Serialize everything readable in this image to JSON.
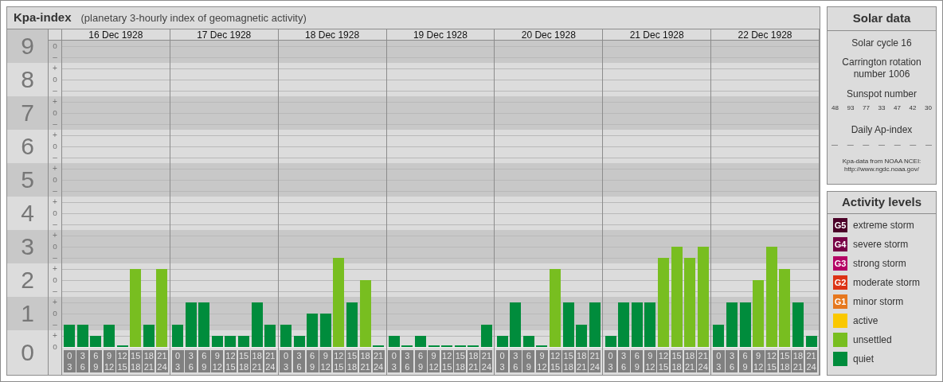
{
  "kpa_panel": {
    "title": "Kpa-index",
    "subtitle": "(planetary 3-hourly index of geomagnetic activity)",
    "minor_tick_labels": [
      "o",
      "–",
      "+",
      "o",
      "–",
      "+",
      "o",
      "–",
      "+",
      "o",
      "–",
      "+",
      "o",
      "–",
      "+",
      "o",
      "–",
      "+",
      "o",
      "–",
      "+",
      "o",
      "–",
      "+",
      "o",
      "–",
      "+",
      "o"
    ],
    "day_labels": [
      "16 Dec 1928",
      "17 Dec 1928",
      "18 Dec 1928",
      "19 Dec 1928",
      "20 Dec 1928",
      "21 Dec 1928",
      "22 Dec 1928"
    ],
    "chart_data": {
      "type": "bar",
      "ylim": [
        0,
        9.17
      ],
      "grid": true,
      "yticks": [
        {
          "value": 9,
          "label": "9"
        },
        {
          "value": 8,
          "label": "8"
        },
        {
          "value": 7,
          "label": "7"
        },
        {
          "value": 6,
          "label": "6"
        },
        {
          "value": 5,
          "label": "5"
        },
        {
          "value": 4,
          "label": "4"
        },
        {
          "value": 3,
          "label": "3"
        },
        {
          "value": 2,
          "label": "2"
        },
        {
          "value": 1,
          "label": "1"
        },
        {
          "value": 0,
          "label": "0"
        }
      ],
      "categories": [
        "0 3",
        "3 6",
        "6 9",
        "9 12",
        "12 15",
        "15 18",
        "18 21",
        "21 24",
        "0 3",
        "3 6",
        "6 9",
        "9 12",
        "12 15",
        "15 18",
        "18 21",
        "21 24",
        "0 3",
        "3 6",
        "6 9",
        "9 12",
        "12 15",
        "15 18",
        "18 21",
        "21 24",
        "0 3",
        "3 6",
        "6 9",
        "9 12",
        "12 15",
        "15 18",
        "18 21",
        "21 24",
        "0 3",
        "3 6",
        "6 9",
        "9 12",
        "12 15",
        "15 18",
        "18 21",
        "21 24",
        "0 3",
        "3 6",
        "6 9",
        "9 12",
        "12 15",
        "15 18",
        "18 21",
        "21 24",
        "0 3",
        "3 6",
        "6 9",
        "9 12",
        "12 15",
        "15 18",
        "18 21",
        "21 24"
      ],
      "series": [
        {
          "color": "#008c3c",
          "values": [
            0.67,
            0.67,
            0.33,
            0.67,
            0,
            null,
            0.67,
            null,
            0.67,
            1.33,
            1.33,
            0.33,
            0.33,
            0.33,
            1.33,
            0.67,
            0.67,
            0.33,
            1,
            1,
            null,
            1.33,
            null,
            0,
            0.33,
            0,
            0.33,
            0,
            0,
            0,
            0,
            0.67,
            0.33,
            1.33,
            0.33,
            0,
            null,
            1.33,
            0.67,
            1.33,
            0.33,
            1.33,
            1.33,
            1.33,
            null,
            null,
            null,
            null,
            0.67,
            1.33,
            1.33,
            null,
            null,
            null,
            1.33,
            0.33
          ]
        },
        {
          "color": "#78be20",
          "values": [
            null,
            null,
            null,
            null,
            null,
            2.33,
            null,
            2.33,
            null,
            null,
            null,
            null,
            null,
            null,
            null,
            null,
            null,
            null,
            null,
            null,
            2.67,
            null,
            2,
            null,
            null,
            null,
            null,
            null,
            null,
            null,
            null,
            null,
            null,
            null,
            null,
            null,
            2.33,
            null,
            null,
            null,
            null,
            null,
            null,
            null,
            2.67,
            3,
            2.67,
            3,
            null,
            null,
            null,
            2,
            3,
            2.33,
            null,
            null
          ]
        }
      ]
    }
  },
  "solar_data": {
    "title": "Solar data",
    "solar_cycle": "Solar cycle 16",
    "carrington": "Carrington rotation number 1006",
    "sunspot_heading": "Sunspot number",
    "sunspot_values": [
      "48",
      "93",
      "77",
      "33",
      "47",
      "42",
      "30"
    ],
    "ap_heading": "Daily Ap-index",
    "ap_values": [
      "—",
      "—",
      "—",
      "—",
      "—",
      "—",
      "—"
    ],
    "source_lines": [
      "Kpa-data from NOAA NCEI:",
      "http://www.ngdc.noaa.gov/"
    ]
  },
  "activity_levels": {
    "title": "Activity levels",
    "items": [
      {
        "badge": "G5",
        "label": "extreme storm",
        "color": "#4b0028"
      },
      {
        "badge": "G4",
        "label": "severe storm",
        "color": "#780046"
      },
      {
        "badge": "G3",
        "label": "strong storm",
        "color": "#b40064"
      },
      {
        "badge": "G2",
        "label": "moderate storm",
        "color": "#dc3214"
      },
      {
        "badge": "G1",
        "label": "minor storm",
        "color": "#e6781e"
      },
      {
        "label": "active",
        "color": "#fac800"
      },
      {
        "label": "unsettled",
        "color": "#78be20"
      },
      {
        "label": "quiet",
        "color": "#008c3c"
      }
    ]
  }
}
